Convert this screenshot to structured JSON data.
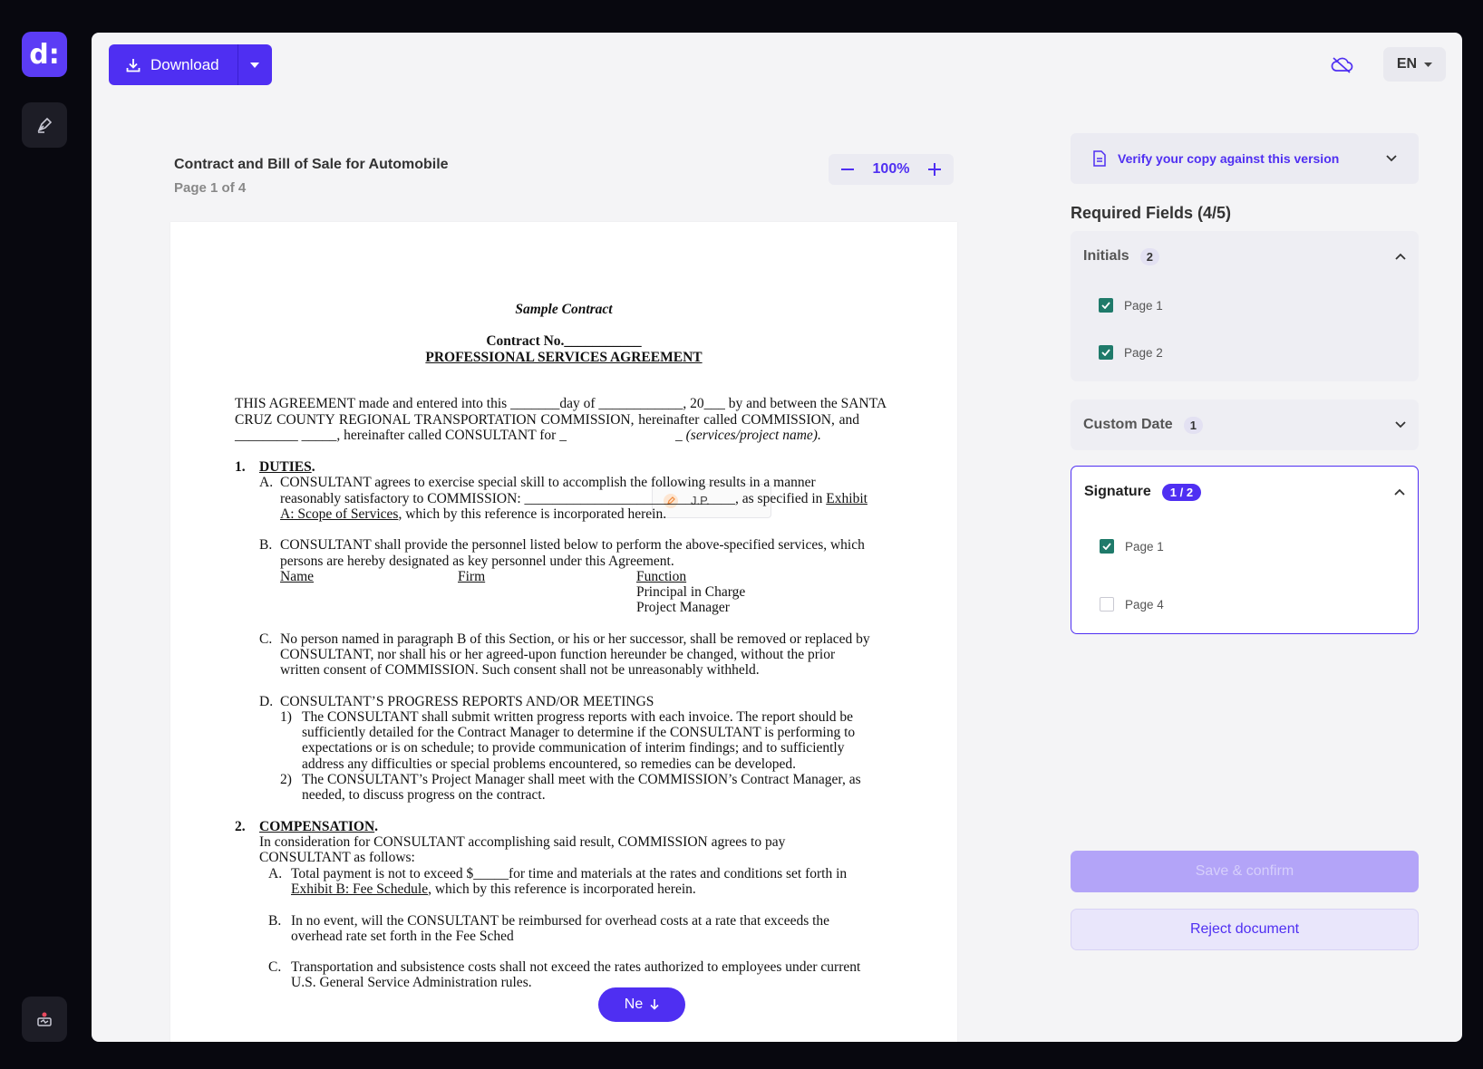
{
  "app": {
    "logo_text": "d:"
  },
  "toolbar": {
    "download_label": "Download",
    "language": "EN"
  },
  "document": {
    "title": "Contract and Bill of Sale for Automobile",
    "page_indicator": "Page 1 of 4",
    "zoom": "100%"
  },
  "contract": {
    "heading": "Sample Contract",
    "number": "Contract No.___________",
    "agreement_title": "PROFESSIONAL SERVICES AGREEMENT",
    "intro_l1": "THIS AGREEMENT made and entered into this _______day of ____________, 20___ by and between the SANTA",
    "intro_l2": "CRUZ COUNTY REGIONAL TRANSPORTATION COMMISSION, hereinafter called COMMISSION, and",
    "intro_l3a": "_________ _____, hereinafter called CONSULTANT for _",
    "intro_l3b": "_ (services/project name).",
    "s1_num": "1.",
    "s1_title": "DUTIES",
    "s1_dot": ".",
    "a_label": "A.",
    "a_l1": "CONSULTANT agrees to exercise special skill to accomplish the following results in a manner",
    "a_l2a": "reasonably satisfactory to COMMISSION: ______________________________, as specified in ",
    "a_l2b": "Exhibit",
    "a_l3a": "A: Scope of Services",
    "a_l3b": ", which by this reference is incorporated herein.",
    "b_label": "B.",
    "b_l1": "CONSULTANT shall provide the personnel listed below to perform the above-specified services, which",
    "b_l2": "persons are hereby designated as key personnel under this Agreement.",
    "col_name": "Name",
    "col_firm": "Firm",
    "col_function": "Function",
    "fn_1": "Principal in Charge",
    "fn_2": "Project Manager",
    "c_label": "C.",
    "c_l1": "No person named in paragraph B of this Section, or his or her successor, shall be removed or replaced by",
    "c_l2": "CONSULTANT, nor shall his or her agreed-upon function hereunder be changed, without the prior",
    "c_l3": "written consent of COMMISSION.  Such consent shall not be unreasonably withheld.",
    "d_label": "D.",
    "d_title": "CONSULTANT’S PROGRESS REPORTS AND/OR MEETINGS",
    "d1_num": "1)",
    "d1_l1": "The CONSULTANT shall submit written progress reports with each invoice. The report should be",
    "d1_l2": "sufficiently detailed for the Contract Manager to determine if the CONSULTANT is performing to",
    "d1_l3": "expectations or is on schedule; to provide communication of interim findings; and to sufficiently",
    "d1_l4": "address any difficulties or special problems encountered, so remedies can be developed.",
    "d2_num": "2)",
    "d2_l1": "The CONSULTANT’s Project Manager shall meet with the COMMISSION’s Contract Manager, as",
    "d2_l2": "needed, to discuss progress on the contract.",
    "s2_num": "2.",
    "s2_title": "COMPENSATION",
    "s2_dot": ".",
    "s2_l1": "In consideration for CONSULTANT accomplishing said result, COMMISSION agrees to pay",
    "s2_l2": "CONSULTANT as follows:",
    "s2a_label": "A.",
    "s2a_l1": "Total payment is not to exceed $_____for time and materials at the rates and conditions set forth in",
    "s2a_l2a": "Exhibit B: Fee Schedule",
    "s2a_l2b": ", which by this reference is incorporated herein.",
    "s2b_label": "B.",
    "s2b_l1": "In no event, will the CONSULTANT be reimbursed for overhead costs at a rate that exceeds the",
    "s2b_l2": "overhead rate set forth in the Fee Sched",
    "s2c_label": "C.",
    "s2c_l1": "Transportation and subsistence costs shall not exceed the rates authorized to employees under current",
    "s2c_l2": "U.S. General Service Administration rules."
  },
  "initial_chip": {
    "text": "J.P."
  },
  "next_button": {
    "label": "Ne"
  },
  "panel": {
    "verify_label": "Verify your copy against this version",
    "required_title": "Required Fields (4/5)",
    "initials": {
      "label": "Initials",
      "count": "2",
      "items": [
        "Page 1",
        "Page 2"
      ]
    },
    "custom_date": {
      "label": "Custom Date",
      "count": "1"
    },
    "signature": {
      "label": "Signature",
      "count": "1 / 2",
      "items": [
        "Page 1",
        "Page 4"
      ]
    },
    "save_label": "Save & confirm",
    "reject_label": "Reject document"
  },
  "colors": {
    "accent": "#4f2ff2",
    "check": "#1f7a6a"
  }
}
